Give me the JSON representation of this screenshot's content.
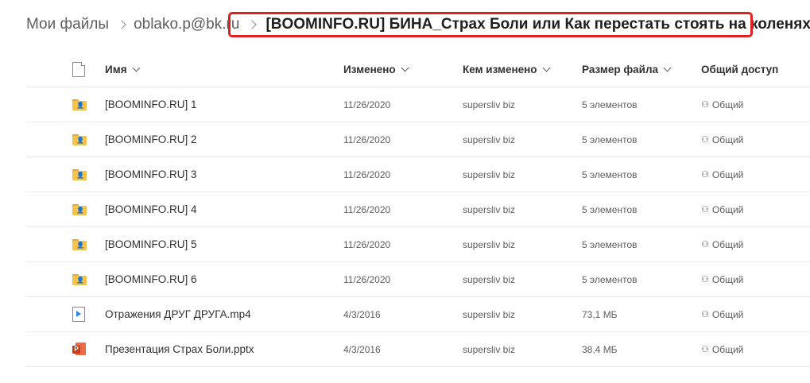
{
  "breadcrumb": {
    "items": [
      "Мои файлы",
      "oblako.p@bk.ru"
    ],
    "current": "[BOOMINFO.RU] БИНА_Страх Боли или Как перестать стоять на коленях"
  },
  "columns": {
    "name": "Имя",
    "modified": "Изменено",
    "modified_by": "Кем изменено",
    "size": "Размер файла",
    "sharing": "Общий доступ"
  },
  "rows": [
    {
      "icon": "folder-icon",
      "name": "[BOOMINFO.RU] 1",
      "modified": "11/26/2020",
      "modified_by": "supersliv biz",
      "size": "5 элементов",
      "sharing": "Общий"
    },
    {
      "icon": "folder-icon",
      "name": "[BOOMINFO.RU] 2",
      "modified": "11/26/2020",
      "modified_by": "supersliv biz",
      "size": "5 элементов",
      "sharing": "Общий"
    },
    {
      "icon": "folder-icon",
      "name": "[BOOMINFO.RU] 3",
      "modified": "11/26/2020",
      "modified_by": "supersliv biz",
      "size": "5 элементов",
      "sharing": "Общий"
    },
    {
      "icon": "folder-icon",
      "name": "[BOOMINFO.RU] 4",
      "modified": "11/26/2020",
      "modified_by": "supersliv biz",
      "size": "5 элементов",
      "sharing": "Общий"
    },
    {
      "icon": "folder-icon",
      "name": "[BOOMINFO.RU] 5",
      "modified": "11/26/2020",
      "modified_by": "supersliv biz",
      "size": "5 элементов",
      "sharing": "Общий"
    },
    {
      "icon": "folder-icon",
      "name": "[BOOMINFO.RU] 6",
      "modified": "11/26/2020",
      "modified_by": "supersliv biz",
      "size": "5 элементов",
      "sharing": "Общий"
    },
    {
      "icon": "video-file-icon",
      "name": "Отражения ДРУГ ДРУГА.mp4",
      "modified": "4/3/2016",
      "modified_by": "supersliv biz",
      "size": "73,1 МБ",
      "sharing": "Общий"
    },
    {
      "icon": "powerpoint-file-icon",
      "name": "Презентация Страх Боли.pptx",
      "modified": "4/3/2016",
      "modified_by": "supersliv biz",
      "size": "38,4 МБ",
      "sharing": "Общий"
    }
  ],
  "colors": {
    "folder": "#f5c24c",
    "highlight": "#e0211f",
    "ppt": "#c43e1c",
    "video": "#2b88d8"
  }
}
